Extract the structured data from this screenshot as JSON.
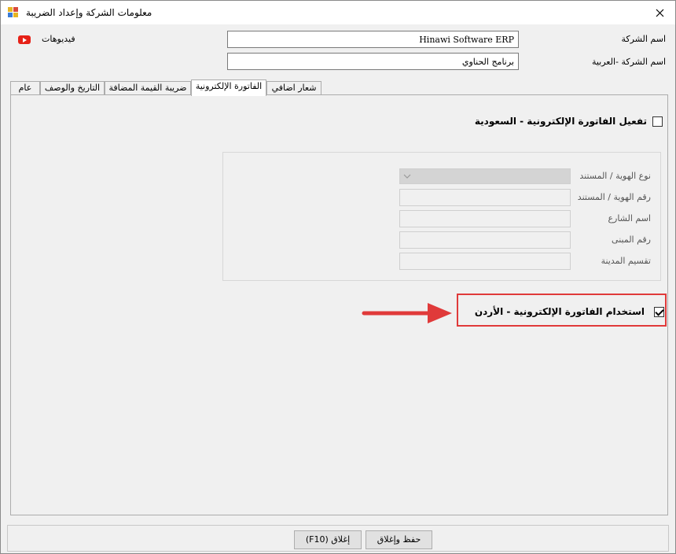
{
  "window": {
    "title": "معلومات الشركة وإعداد الضريبة"
  },
  "header": {
    "company_name_label": "اسم الشركة",
    "company_name_value": "Hinawi Software ERP",
    "company_name_ar_label": "اسم الشركة -العربية",
    "company_name_ar_value": "برنامج الحناوي",
    "videos_label": "فيديوهات"
  },
  "tabs": [
    {
      "label": "عام"
    },
    {
      "label": "التاريخ والوصف"
    },
    {
      "label": "ضريبة القيمة المضافة"
    },
    {
      "label": "الفاتورة الإلكترونية",
      "active": true
    },
    {
      "label": "شعار اضافي"
    }
  ],
  "einvoice": {
    "saudi_checkbox_label": "تفعيل الفاتورة الإلكترونية - السعودية",
    "saudi_checked": false,
    "fields": [
      {
        "label": "نوع الهوية / المستند",
        "type": "select",
        "value": ""
      },
      {
        "label": "رقم الهوية / المستند",
        "type": "text",
        "value": ""
      },
      {
        "label": "اسم الشارع",
        "type": "text",
        "value": ""
      },
      {
        "label": "رقم المبنى",
        "type": "text",
        "value": ""
      },
      {
        "label": "تقسيم المدينة",
        "type": "text",
        "value": ""
      }
    ],
    "jordan_checkbox_label": "استخدام الفاتورة الإلكترونية - الأردن",
    "jordan_checked": true,
    "highlight_color": "#e03a3a"
  },
  "footer": {
    "save_close_label": "حفظ وإغلاق",
    "close_label": "إغلاق (F10)"
  }
}
